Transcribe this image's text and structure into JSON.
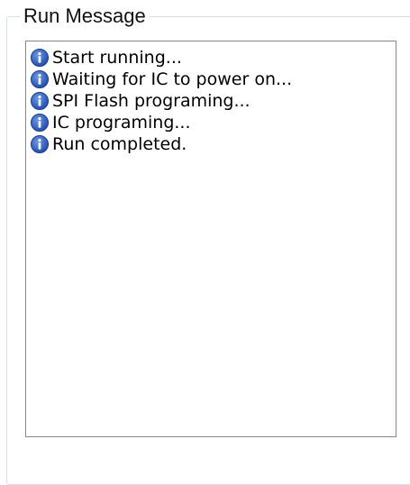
{
  "group": {
    "title": "Run Message"
  },
  "messages": [
    {
      "icon": "info-icon",
      "text": "Start running..."
    },
    {
      "icon": "info-icon",
      "text": "Waiting for IC to power on..."
    },
    {
      "icon": "info-icon",
      "text": "SPI Flash programing..."
    },
    {
      "icon": "info-icon",
      "text": "IC programing..."
    },
    {
      "icon": "info-icon",
      "text": "Run completed."
    }
  ],
  "colors": {
    "info_icon": "#1f4fb5"
  }
}
